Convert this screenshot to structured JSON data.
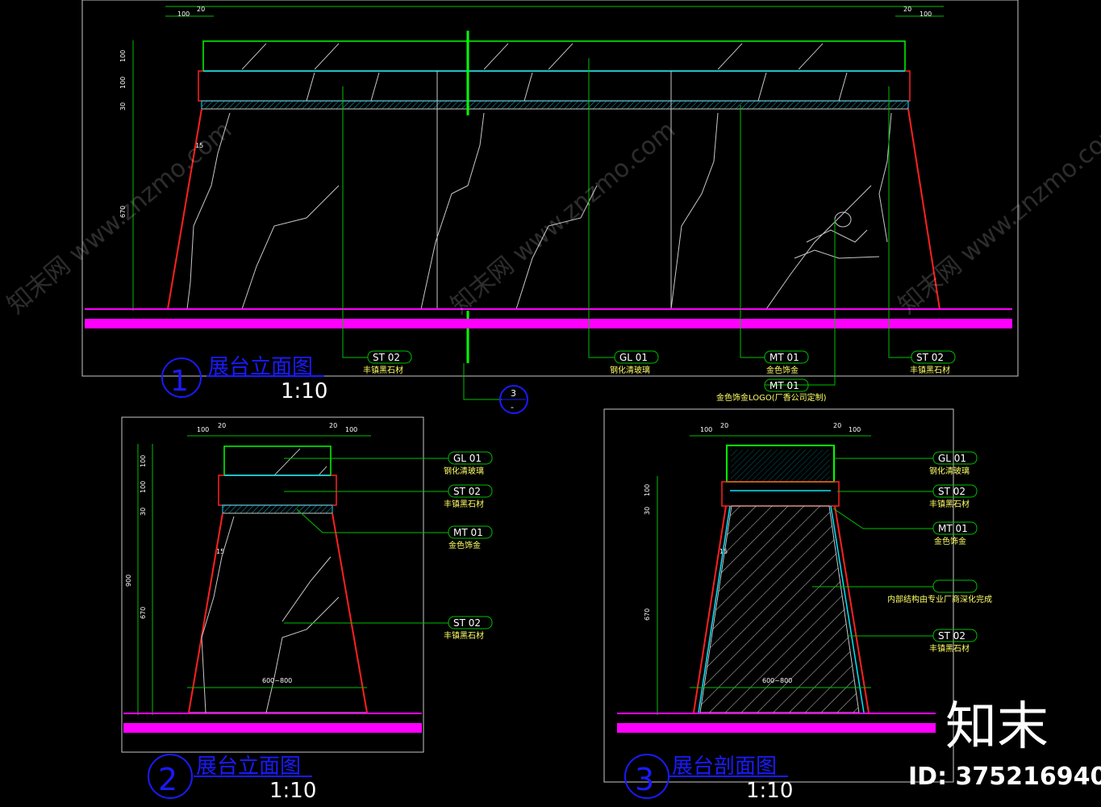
{
  "colors": {
    "background": "#000000",
    "frame": "#c8c8c8",
    "glass": "#00ff00",
    "stone": "#00e5ff",
    "taper": "#ff2020",
    "floor": "#ff00ff",
    "leader": "#00c000",
    "label_text": "#ffffff",
    "note_text": "#ffff66",
    "title": "#1a1aff"
  },
  "view1": {
    "number": "1",
    "title": "展台立面图",
    "scale": "1:10",
    "dims": {
      "top_l1": "100",
      "top_l2": "20",
      "top_r1": "20",
      "top_r2": "100",
      "v1": "100",
      "v2": "100",
      "v3": "30",
      "v4": "15",
      "v5": "670"
    },
    "callouts": [
      {
        "code": "ST 02",
        "note": "丰镇黑石材"
      },
      {
        "code": "GL 01",
        "note": "钢化清玻璃"
      },
      {
        "code": "MT 01",
        "note": "金色饰金"
      },
      {
        "code": "ST 02",
        "note": "丰镇黑石材"
      }
    ],
    "logo_callout": {
      "code": "MT 01",
      "note": "金色饰金LOGO(厂香公司定制)"
    },
    "section_marker": {
      "top": "3",
      "bottom": "-"
    }
  },
  "view2": {
    "number": "2",
    "title": "展台立面图",
    "scale": "1:10",
    "dims": {
      "top_l1": "100",
      "top_l2": "20",
      "top_r1": "20",
      "top_r2": "100",
      "v1": "100",
      "v2": "100",
      "v3": "30",
      "v4": "15",
      "v5": "670",
      "total": "900",
      "width": "600~800"
    },
    "callouts": [
      {
        "code": "GL 01",
        "note": "钢化清玻璃"
      },
      {
        "code": "ST 02",
        "note": "丰镇黑石材"
      },
      {
        "code": "MT 01",
        "note": "金色饰金"
      },
      {
        "code": "ST 02",
        "note": "丰镇黑石材"
      }
    ]
  },
  "view3": {
    "number": "3",
    "title": "展台剖面图",
    "scale": "1:10",
    "dims": {
      "top_l1": "100",
      "top_l2": "20",
      "top_r1": "20",
      "top_r2": "100",
      "v1": "100",
      "v2": "30",
      "v3": "15",
      "v4": "670",
      "width": "600~800"
    },
    "callouts": [
      {
        "code": "GL 01",
        "note": "钢化清玻璃"
      },
      {
        "code": "ST 02",
        "note": "丰镇黑石材"
      },
      {
        "code": "MT 01",
        "note": "金色饰金"
      },
      {
        "code": "",
        "note": "内部结构由专业厂商深化完成"
      },
      {
        "code": "ST 02",
        "note": "丰镇黑石材"
      }
    ]
  },
  "watermark": {
    "logo_text": "知末",
    "id_text": "ID: 375216940",
    "diag_text": "知末网 www.znzmo.com"
  }
}
